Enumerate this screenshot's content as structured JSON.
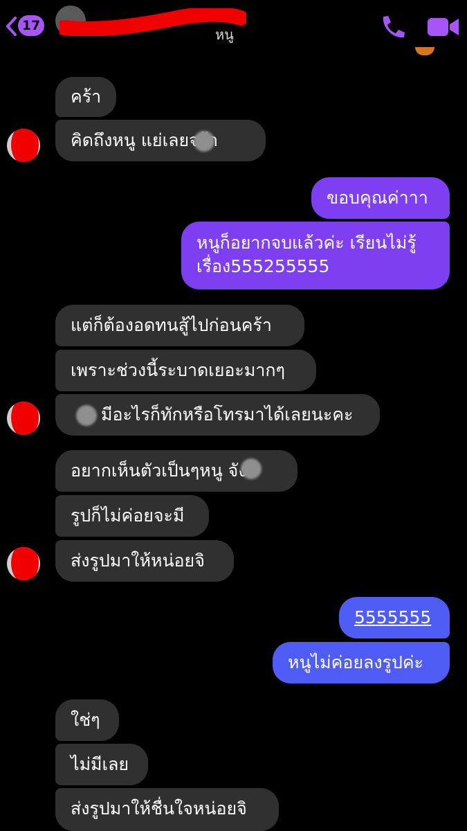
{
  "header": {
    "back_badge": "17",
    "contact_name": "หนู",
    "icons": {
      "back": "chevron-left-icon",
      "call": "phone-icon",
      "video": "video-camera-icon"
    }
  },
  "messages": [
    {
      "side": "in",
      "text": "คร้า"
    },
    {
      "side": "in",
      "text": "คิดถึงหนู  แย่เลยจร้า"
    },
    {
      "side": "out",
      "text": "ขอบคุณค่าาา"
    },
    {
      "side": "out",
      "line1": "หนูก็อยากจบแล้วค่ะ เรียนไม่รู้",
      "line2": "เรื่อง555255555"
    },
    {
      "side": "in",
      "text": "แต่ก็ต้องอดทนสู้ไปก่อนคร้า"
    },
    {
      "side": "in",
      "text": "เพราะช่วงนี้ระบาดเยอะมากๆ"
    },
    {
      "side": "in",
      "text": "มีอะไรก็ทักหรือโทรมาได้เลยนะคะ"
    },
    {
      "side": "in",
      "text": "อยากเห็นตัวเป็นๆหนู  จัง"
    },
    {
      "side": "in",
      "text": "รูปก็ไม่ค่อยจะมี"
    },
    {
      "side": "in",
      "text": "ส่งรูปมาให้หน่อยจิ"
    },
    {
      "side": "out",
      "text": "5555555"
    },
    {
      "side": "out",
      "text": "หนูไม่ค่อยลงรูปค่ะ"
    },
    {
      "side": "in",
      "text": "ใช่ๆ"
    },
    {
      "side": "in",
      "text": "ไม่มีเลย"
    },
    {
      "side": "in",
      "text": "ส่งรูปมาให้ชื่นใจหน่อยจิ"
    }
  ],
  "colors": {
    "background": "#000000",
    "incoming": "#303030",
    "outgoing_purple": "#7e3ff2",
    "outgoing_blue": "#4f5cf5",
    "accent": "#a855f7",
    "redaction": "#f00000"
  }
}
